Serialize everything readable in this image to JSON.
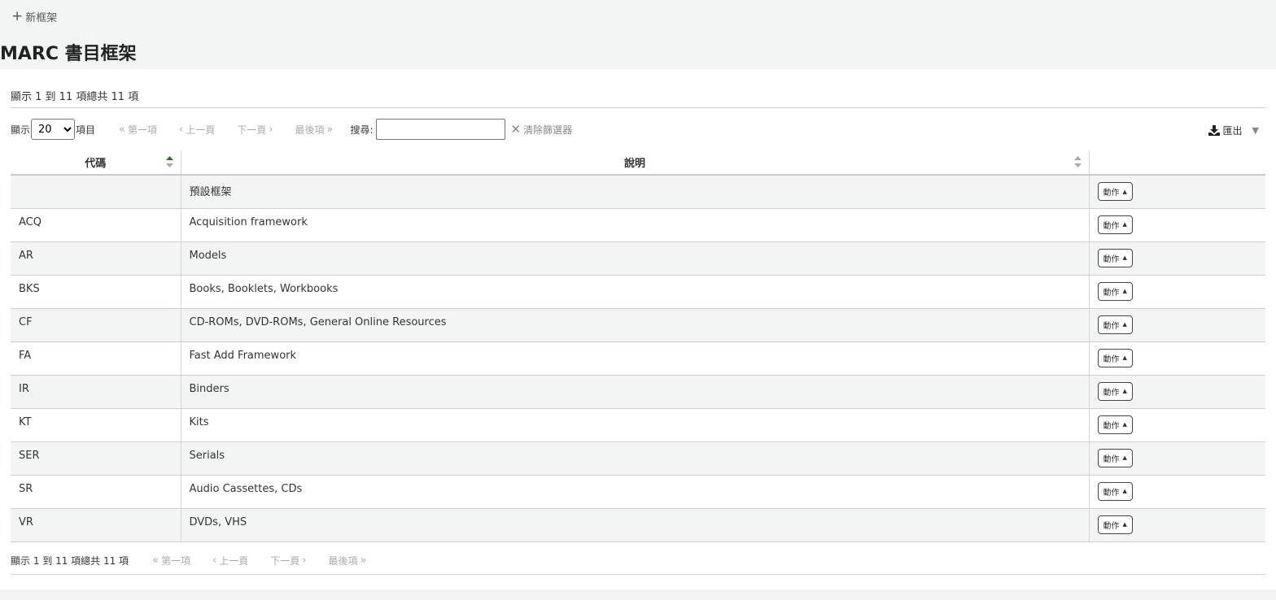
{
  "toolbar": {
    "new_framework_label": "新框架"
  },
  "page_title": "MARC 書目框架",
  "info_text": "顯示 1 到 11 項總共 11 項",
  "controls": {
    "show_label": "顯示",
    "page_size": "20",
    "entries_label": "項目",
    "first": "第一項",
    "previous": "上一頁",
    "next": "下一頁",
    "last": "最後項",
    "search_label": "搜尋:",
    "search_value": "",
    "clear_filter": "清除篩選器",
    "export": "匯出"
  },
  "table": {
    "headers": {
      "code": "代碼",
      "description": "說明"
    },
    "action_label": "動作",
    "rows": [
      {
        "code": "",
        "description": "預設框架"
      },
      {
        "code": "ACQ",
        "description": "Acquisition framework"
      },
      {
        "code": "AR",
        "description": "Models"
      },
      {
        "code": "BKS",
        "description": "Books, Booklets, Workbooks"
      },
      {
        "code": "CF",
        "description": "CD-ROMs, DVD-ROMs, General Online Resources"
      },
      {
        "code": "FA",
        "description": "Fast Add Framework"
      },
      {
        "code": "IR",
        "description": "Binders"
      },
      {
        "code": "KT",
        "description": "Kits"
      },
      {
        "code": "SER",
        "description": "Serials"
      },
      {
        "code": "SR",
        "description": "Audio Cassettes, CDs"
      },
      {
        "code": "VR",
        "description": "DVDs, VHS"
      }
    ]
  },
  "colors": {
    "sort_active": "#1a7a1a",
    "sort_inactive": "#aaaaaa"
  }
}
